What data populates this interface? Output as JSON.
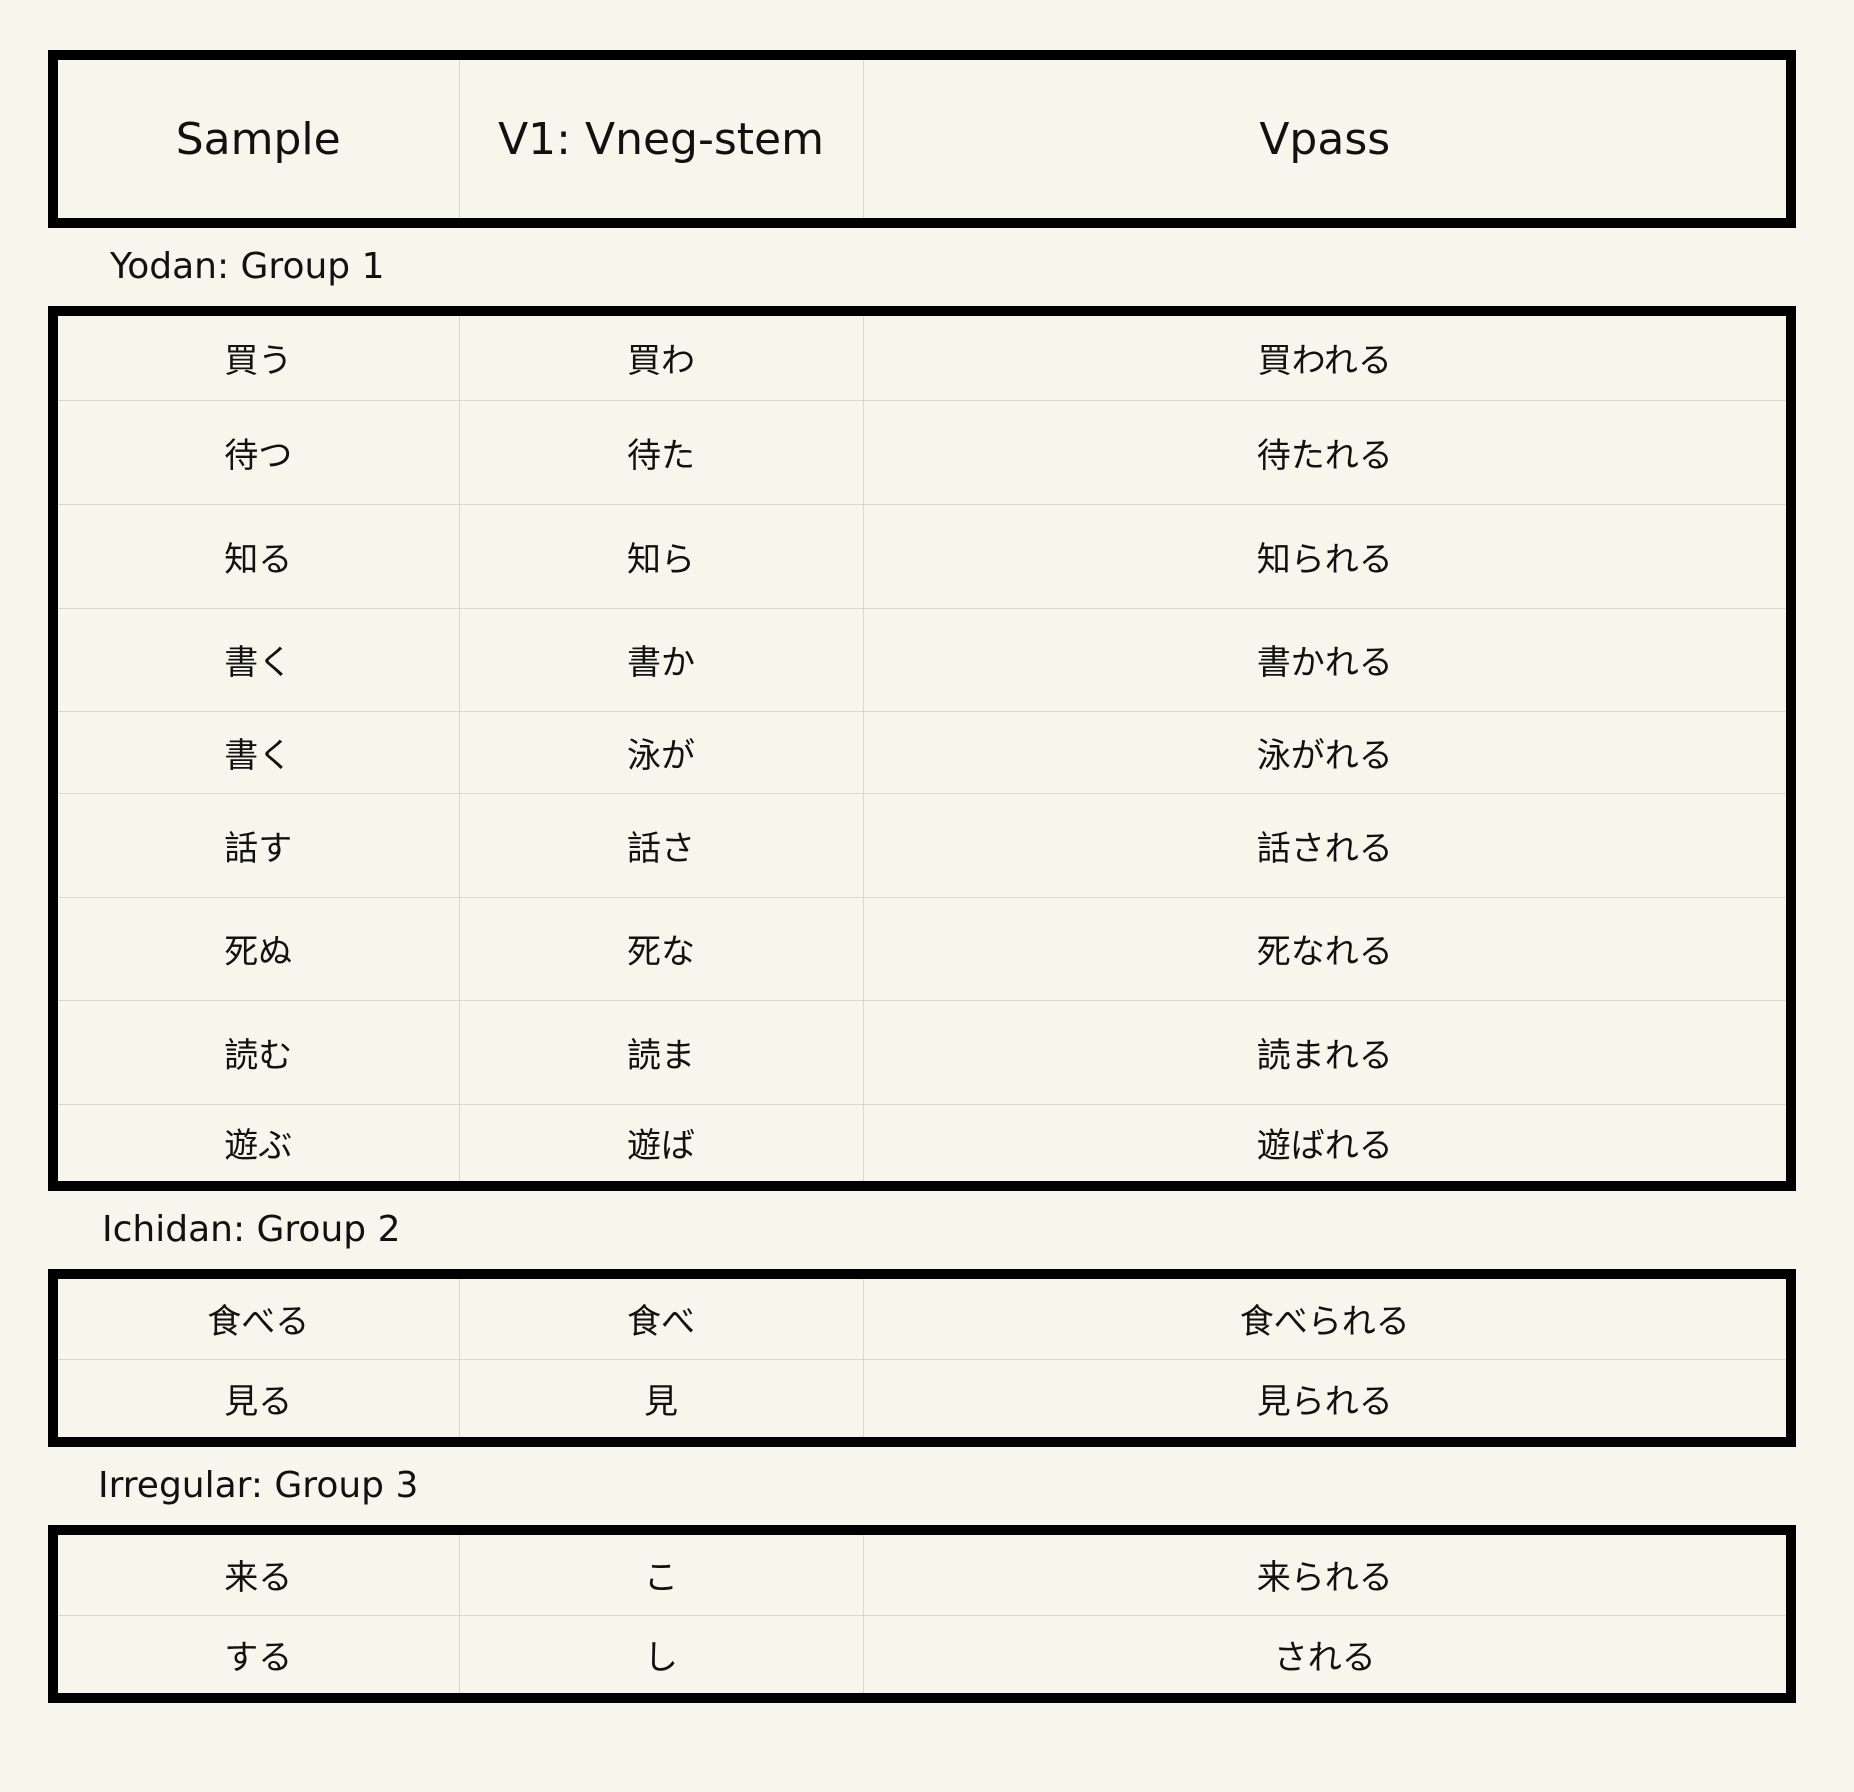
{
  "header": {
    "col_sample": "Sample",
    "col_stem": "V1: Vneg-stem",
    "col_pass": "Vpass"
  },
  "groups": [
    {
      "label": "Yodan: Group 1",
      "rows": [
        {
          "sample": "買う",
          "stem": "買わ",
          "pass": "買われる"
        },
        {
          "sample": "待つ",
          "stem": "待た",
          "pass": "待たれる"
        },
        {
          "sample": "知る",
          "stem": "知ら",
          "pass": "知られる"
        },
        {
          "sample": "書く",
          "stem": "書か",
          "pass": "書かれる"
        },
        {
          "sample": "書く",
          "stem": "泳が",
          "pass": "泳がれる"
        },
        {
          "sample": "話す",
          "stem": "話さ",
          "pass": "話される"
        },
        {
          "sample": "死ぬ",
          "stem": "死な",
          "pass": "死なれる"
        },
        {
          "sample": "読む",
          "stem": "読ま",
          "pass": "読まれる"
        },
        {
          "sample": "遊ぶ",
          "stem": "遊ば",
          "pass": "遊ばれる"
        }
      ]
    },
    {
      "label": "Ichidan: Group 2",
      "rows": [
        {
          "sample": "食べる",
          "stem": "食べ",
          "pass": "食べられる"
        },
        {
          "sample": "見る",
          "stem": "見",
          "pass": "見られる"
        }
      ]
    },
    {
      "label": "Irregular: Group 3",
      "rows": [
        {
          "sample": "来る",
          "stem": "こ",
          "pass": "来られる"
        },
        {
          "sample": "する",
          "stem": "し",
          "pass": "される"
        }
      ]
    }
  ]
}
